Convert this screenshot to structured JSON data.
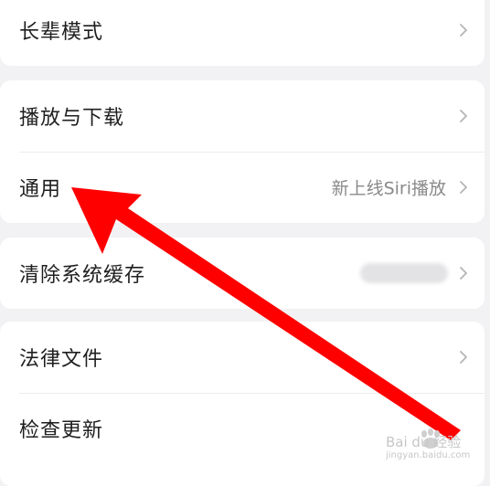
{
  "settings": {
    "elder_mode": {
      "label": "长辈模式"
    },
    "playback_download": {
      "label": "播放与下载"
    },
    "general": {
      "label": "通用",
      "value": "新上线Siri播放"
    },
    "clear_cache": {
      "label": "清除系统缓存"
    },
    "legal": {
      "label": "法律文件"
    },
    "check_update": {
      "label": "检查更新"
    }
  },
  "annotation": {
    "arrow_color": "#ff0000"
  },
  "watermark": {
    "brand": "Bai du 经验",
    "url": "jingyan.baidu.com"
  },
  "icons": {
    "chevron": "chevron-right-icon"
  }
}
